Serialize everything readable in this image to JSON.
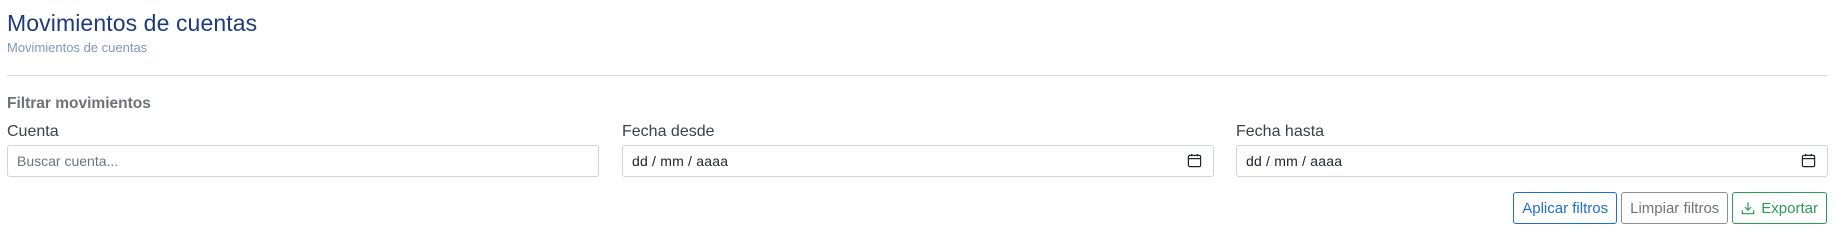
{
  "header": {
    "title": "Movimientos de cuentas",
    "breadcrumb": "Movimientos de cuentas"
  },
  "filters": {
    "section_title": "Filtrar movimientos",
    "account": {
      "label": "Cuenta",
      "placeholder": "Buscar cuenta..."
    },
    "date_from": {
      "label": "Fecha desde",
      "value": "dd / mm / aaaa",
      "icon": "calendar-icon"
    },
    "date_to": {
      "label": "Fecha hasta",
      "value": "dd / mm / aaaa",
      "icon": "calendar-icon"
    }
  },
  "actions": {
    "apply_label": "Aplicar filtros",
    "clear_label": "Limpiar filtros",
    "export_label": "Exportar",
    "export_icon": "download-icon"
  },
  "colors": {
    "title": "#1d3b7a",
    "breadcrumb": "#7f97c2",
    "apply": "#1f6fd1",
    "clear": "#6c757d",
    "export": "#2a9d54"
  }
}
